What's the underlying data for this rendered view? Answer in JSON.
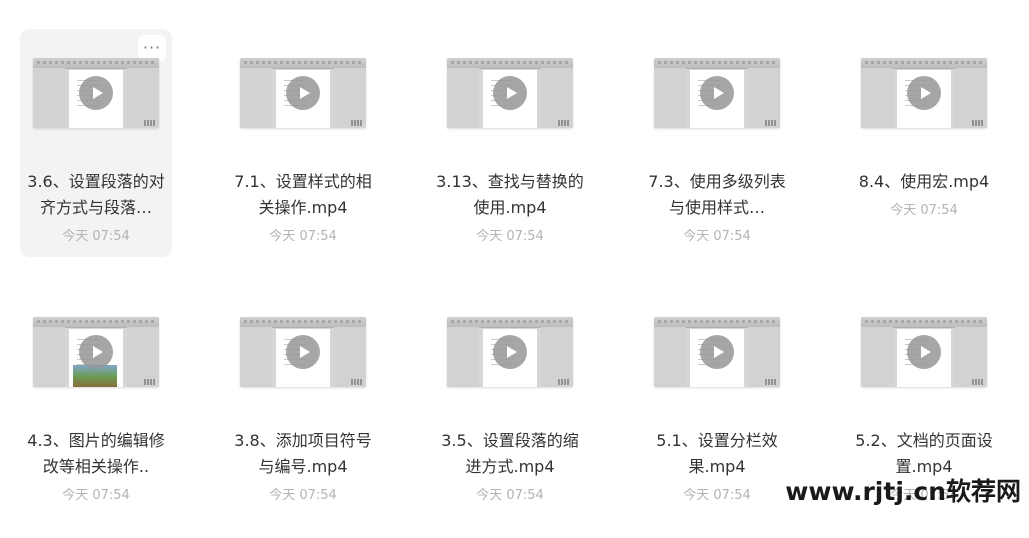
{
  "files": [
    {
      "name": "3.6、设置段落的对齐方式与段落…",
      "time": "今天 07:54",
      "selected": true
    },
    {
      "name": "7.1、设置样式的相关操作.mp4",
      "time": "今天 07:54"
    },
    {
      "name": "3.13、查找与替换的使用.mp4",
      "time": "今天 07:54"
    },
    {
      "name": "7.3、使用多级列表与使用样式…",
      "time": "今天 07:54"
    },
    {
      "name": "8.4、使用宏.mp4",
      "time": "今天 07:54"
    },
    {
      "name": "4.3、图片的编辑修改等相关操作..",
      "time": "今天 07:54"
    },
    {
      "name": "3.8、添加项目符号与编号.mp4",
      "time": "今天 07:54"
    },
    {
      "name": "3.5、设置段落的缩进方式.mp4",
      "time": "今天 07:54"
    },
    {
      "name": "5.1、设置分栏效果.mp4",
      "time": "今天 07:54"
    },
    {
      "name": "5.2、文档的页面设置.mp4",
      "time": "今天 07:54"
    }
  ],
  "more_button_label": "···",
  "icons": {
    "more": "more-dots-icon",
    "play": "play-icon",
    "thumbnail": "video-thumbnail"
  },
  "colors": {
    "selected_bg": "#f3f3f3",
    "name_text": "#333333",
    "time_text": "#b3b3b3"
  },
  "watermark": "www.rjtj.cn软荐网"
}
